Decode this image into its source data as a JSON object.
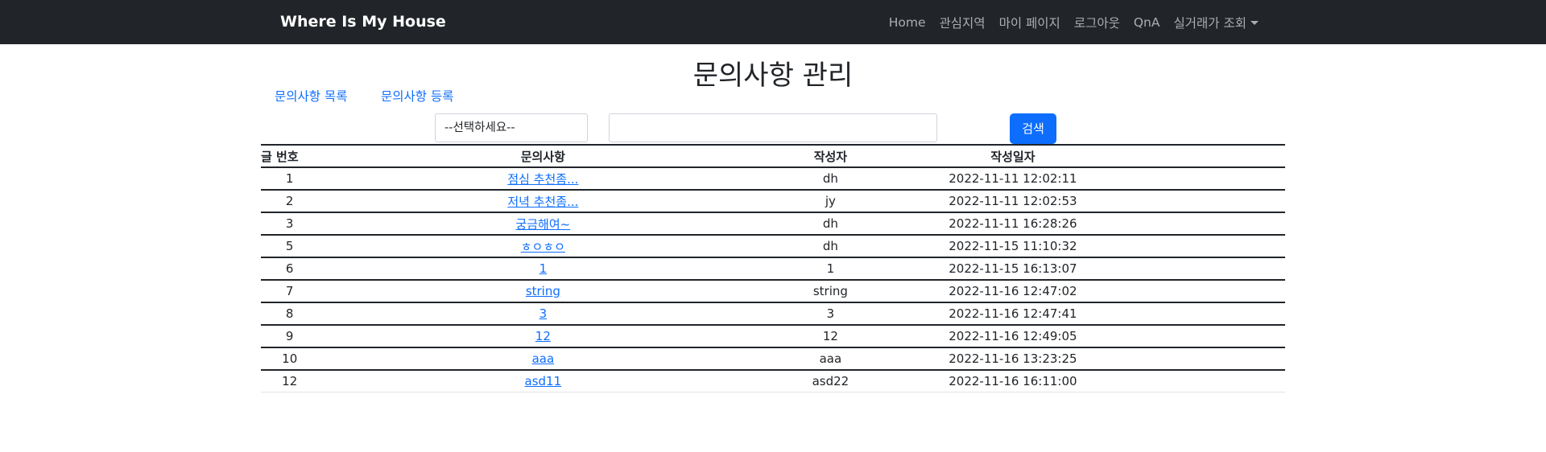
{
  "navbar": {
    "brand": "Where Is My House",
    "items": [
      {
        "label": "Home"
      },
      {
        "label": "관심지역"
      },
      {
        "label": "마이 페이지"
      },
      {
        "label": "로그아웃"
      },
      {
        "label": "QnA"
      },
      {
        "label": "실거래가 조회"
      }
    ]
  },
  "page": {
    "title": "문의사항 관리",
    "links": {
      "list": "문의사항 목록",
      "register": "문의사항 등록"
    }
  },
  "search": {
    "select_value": "--선택하세요--",
    "input_value": "",
    "button_label": "검색"
  },
  "table": {
    "headers": {
      "no": "글 번호",
      "title": "문의사항",
      "author": "작성자",
      "date": "작성일자"
    },
    "rows": [
      {
        "no": "1",
        "title": "점심 추천좀...",
        "author": "dh",
        "date": "2022-11-11 12:02:11"
      },
      {
        "no": "2",
        "title": "저녁 추천좀...",
        "author": "jy",
        "date": "2022-11-11 12:02:53"
      },
      {
        "no": "3",
        "title": "궁금해여~",
        "author": "dh",
        "date": "2022-11-11 16:28:26"
      },
      {
        "no": "5",
        "title": "ㅎㅇㅎㅇ",
        "author": "dh",
        "date": "2022-11-15 11:10:32"
      },
      {
        "no": "6",
        "title": "1",
        "author": "1",
        "date": "2022-11-15 16:13:07"
      },
      {
        "no": "7",
        "title": "string",
        "author": "string",
        "date": "2022-11-16 12:47:02"
      },
      {
        "no": "8",
        "title": "3",
        "author": "3",
        "date": "2022-11-16 12:47:41"
      },
      {
        "no": "9",
        "title": "12",
        "author": "12",
        "date": "2022-11-16 12:49:05"
      },
      {
        "no": "10",
        "title": "aaa",
        "author": "aaa",
        "date": "2022-11-16 13:23:25"
      },
      {
        "no": "12",
        "title": "asd11",
        "author": "asd22",
        "date": "2022-11-16 16:11:00"
      }
    ]
  },
  "colors": {
    "navbar_bg": "#212529",
    "link": "#0d6efd",
    "button": "#0d6efd"
  }
}
